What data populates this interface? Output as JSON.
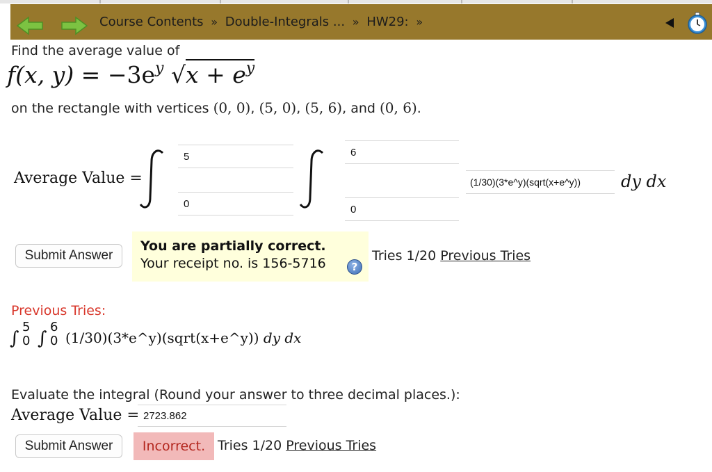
{
  "nav": {
    "breadcrumbs": [
      "Course Contents",
      "Double-Integrals ...",
      "HW29:"
    ],
    "separator": "»",
    "back_icon": "green-left-arrow-icon",
    "forward_icon": "green-right-arrow-icon",
    "menu_icon": "left-triangle-icon",
    "timer_icon": "stopwatch-icon",
    "bar_color": "#97782c"
  },
  "problem": {
    "intro": "Find the average value of",
    "function": {
      "lhs": "f(x, y) =",
      "coef": "−3e",
      "exp1": "y",
      "radicand": "x + e",
      "exp2": "y"
    },
    "vertices_prefix": "on the rectangle with vertices",
    "vertices": [
      "(0, 0)",
      "(5, 0)",
      "(5, 6)",
      "(0, 6)"
    ],
    "vertices_and": "and"
  },
  "part1": {
    "label": "Average Value =",
    "outer_upper": "5",
    "outer_lower": "0",
    "inner_upper": "6",
    "inner_lower": "0",
    "integrand": "(1/30)(3*e^y)(sqrt(x+e^y))",
    "differentials": "dy dx",
    "submit_label": "Submit Answer",
    "feedback_title": "You are partially correct.",
    "feedback_receipt": "Your receipt no. is 156-5716",
    "help_icon": "question-mark-icon",
    "tries_text": "Tries 1/20",
    "previous_tries_link": "Previous Tries"
  },
  "previous": {
    "heading": "Previous Tries:",
    "outer_upper": "5",
    "outer_lower": "0",
    "inner_upper": "6",
    "inner_lower": "0",
    "expr": "(1/30)(3*e^y)(sqrt(x+e^y))",
    "differentials": "dy dx"
  },
  "part2": {
    "prompt": "Evaluate the integral (Round your answer to three decimal places.):",
    "label": "Average Value =",
    "value": "2723.862",
    "submit_label": "Submit Answer",
    "status": "Incorrect.",
    "tries_text": "Tries 1/20",
    "previous_tries_link": "Previous Tries"
  },
  "colors": {
    "feedback_bg": "#ffffdc",
    "incorrect_bg": "#f2b9b9",
    "previous_heading": "#d8362a"
  }
}
